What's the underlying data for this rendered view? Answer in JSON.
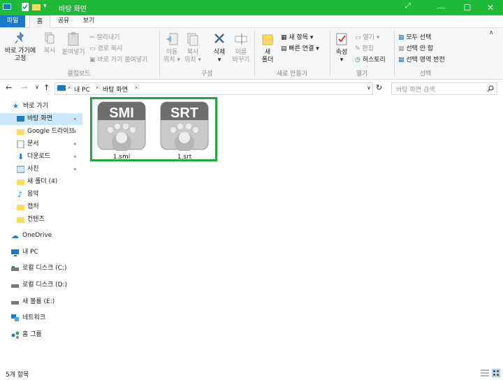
{
  "titlebar": {
    "title": "바탕 화면",
    "restore_glyph": "⤢",
    "minimize_glyph": "—",
    "maximize_glyph": "☐",
    "close_glyph": "✕",
    "bg": "#1fba3a"
  },
  "tabs": {
    "file": "파일",
    "home": "홈",
    "share": "공유",
    "view": "보기"
  },
  "ribbon": {
    "clipboard": {
      "pin": "바로 가기에\n고정",
      "copy": "복사",
      "paste": "붙여넣기",
      "cut": "잘라내기",
      "copy_path": "경로 복사",
      "paste_shortcut": "바로 가기 붙여넣기",
      "label": "클립보드"
    },
    "organize": {
      "move_to": "이동\n위치 ▾",
      "copy_to": "복사\n위치 ▾",
      "delete": "삭제\n▾",
      "rename": "이름\n바꾸기",
      "label": "구성"
    },
    "new": {
      "new_folder": "새\n폴더",
      "new_item": "새 항목 ▾",
      "easy_access": "빠른 연결 ▾",
      "label": "새로 만들기"
    },
    "open": {
      "properties": "속성\n▾",
      "open": "열기 ▾",
      "edit": "편집",
      "history": "히스토리",
      "label": "열기"
    },
    "select": {
      "select_all": "모두 선택",
      "select_none": "선택 안 함",
      "invert": "선택 영역 반전",
      "label": "선택"
    }
  },
  "address": {
    "back": "←",
    "forward": "→",
    "recent": "∨",
    "up": "↑",
    "path": [
      "내 PC",
      "바탕 화면"
    ],
    "dropdown": "∨",
    "refresh": "↻",
    "search_placeholder": "바탕 화면 검색"
  },
  "nav": {
    "quick_access": "바로 가기",
    "items": [
      "바탕 화면",
      "Google 드라이브",
      "문서",
      "다운로드",
      "사진",
      "새 폴더 (4)",
      "음악",
      "캡처",
      "컨텐츠"
    ],
    "onedrive": "OneDrive",
    "thispc": "내 PC",
    "drives": [
      "로컬 디스크 (C:)",
      "로컬 디스크 (D:)",
      "새 볼륨 (E:)"
    ],
    "network": "네트워크",
    "homegroup": "홈 그룹"
  },
  "files": [
    {
      "ext": "SMI",
      "name": "1.smi"
    },
    {
      "ext": "SRT",
      "name": "1.srt"
    }
  ],
  "status": {
    "count": "5개 항목"
  },
  "colors": {
    "accent": "#1979ca",
    "highlight": "#1faa3f"
  }
}
